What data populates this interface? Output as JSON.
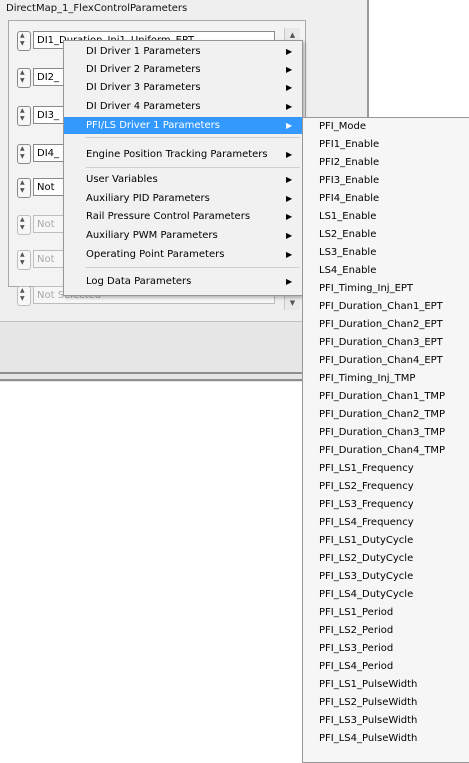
{
  "panel": {
    "title": "DirectMap_1_FlexControlParameters"
  },
  "rings": [
    {
      "value": "DI1_Duration_Inj1_Uniform_EPT"
    },
    {
      "value": "DI2_"
    },
    {
      "value": "DI3_"
    },
    {
      "value": "DI4_"
    },
    {
      "value": "Not"
    },
    {
      "value": "Not"
    },
    {
      "value": "Not"
    },
    {
      "value": "Not Selected"
    }
  ],
  "menu": {
    "items": [
      {
        "label": "DI Driver 1 Parameters"
      },
      {
        "label": "DI Driver 2 Parameters"
      },
      {
        "label": "DI Driver 3 Parameters"
      },
      {
        "label": "DI Driver 4 Parameters"
      },
      {
        "label": "PFI/LS Driver 1 Parameters"
      },
      {
        "label": "Engine Position Tracking Parameters"
      },
      {
        "label": "User Variables"
      },
      {
        "label": "Auxiliary PID Parameters"
      },
      {
        "label": "Rail Pressure Control Parameters"
      },
      {
        "label": "Auxiliary PWM Parameters"
      },
      {
        "label": "Operating Point Parameters"
      },
      {
        "label": "Log Data Parameters"
      }
    ],
    "arrow": "▶"
  },
  "submenu": {
    "items": [
      "PFI_Mode",
      "PFI1_Enable",
      "PFI2_Enable",
      "PFI3_Enable",
      "PFI4_Enable",
      "LS1_Enable",
      "LS2_Enable",
      "LS3_Enable",
      "LS4_Enable",
      "PFI_Timing_Inj_EPT",
      "PFI_Duration_Chan1_EPT",
      "PFI_Duration_Chan2_EPT",
      "PFI_Duration_Chan3_EPT",
      "PFI_Duration_Chan4_EPT",
      "PFI_Timing_Inj_TMP",
      "PFI_Duration_Chan1_TMP",
      "PFI_Duration_Chan2_TMP",
      "PFI_Duration_Chan3_TMP",
      "PFI_Duration_Chan4_TMP",
      "PFI_LS1_Frequency",
      "PFI_LS2_Frequency",
      "PFI_LS3_Frequency",
      "PFI_LS4_Frequency",
      "PFI_LS1_DutyCycle",
      "PFI_LS2_DutyCycle",
      "PFI_LS3_DutyCycle",
      "PFI_LS4_DutyCycle",
      "PFI_LS1_Period",
      "PFI_LS2_Period",
      "PFI_LS3_Period",
      "PFI_LS4_Period",
      "PFI_LS1_PulseWidth",
      "PFI_LS2_PulseWidth",
      "PFI_LS3_PulseWidth",
      "PFI_LS4_PulseWidth"
    ]
  },
  "colors": {
    "highlight": "#3399ff",
    "menu_bg": "#f1f1f1"
  }
}
